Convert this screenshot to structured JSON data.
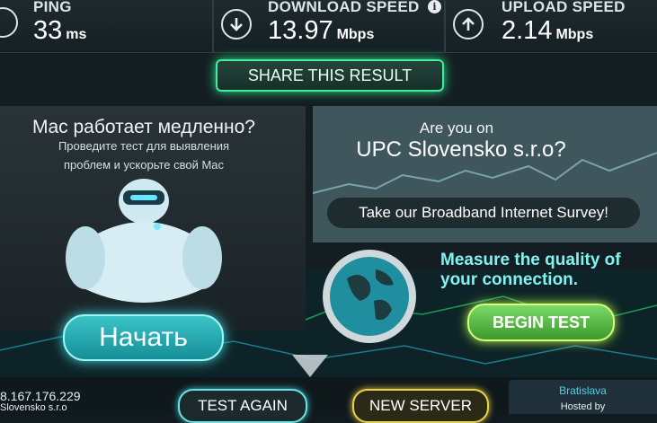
{
  "stats": {
    "ping": {
      "label": "PING",
      "value": "33",
      "unit": "ms"
    },
    "download": {
      "label": "DOWNLOAD SPEED",
      "value": "13.97",
      "unit": "Mbps",
      "info": "i"
    },
    "upload": {
      "label": "UPLOAD SPEED",
      "value": "2.14",
      "unit": "Mbps"
    }
  },
  "share_label": "SHARE THIS RESULT",
  "mac_ad": {
    "title": "Mac работает медленно?",
    "line1": "Проведите тест для выявления",
    "line2": "проблем и ускорьте свой Mac",
    "button": "Начать"
  },
  "isp_prompt": {
    "question": "Are you on",
    "isp": "UPC Slovensko s.r.o?",
    "survey": "Take our Broadband Internet Survey!"
  },
  "measure": {
    "line1": "Measure the quality of",
    "line2": "your connection.",
    "button": "BEGIN TEST"
  },
  "footer": {
    "ip": "8.167.176.229",
    "isp": "Slovensko s.r.o",
    "test_again": "TEST AGAIN",
    "new_server": "NEW SERVER",
    "server_city": "Bratislava",
    "server_host": "Hosted by"
  },
  "colors": {
    "share_glow": "#3df0a0",
    "begin_glow": "#b2ff4e",
    "start_glow": "#39d7e0",
    "new_server_border": "#e6d24b"
  }
}
